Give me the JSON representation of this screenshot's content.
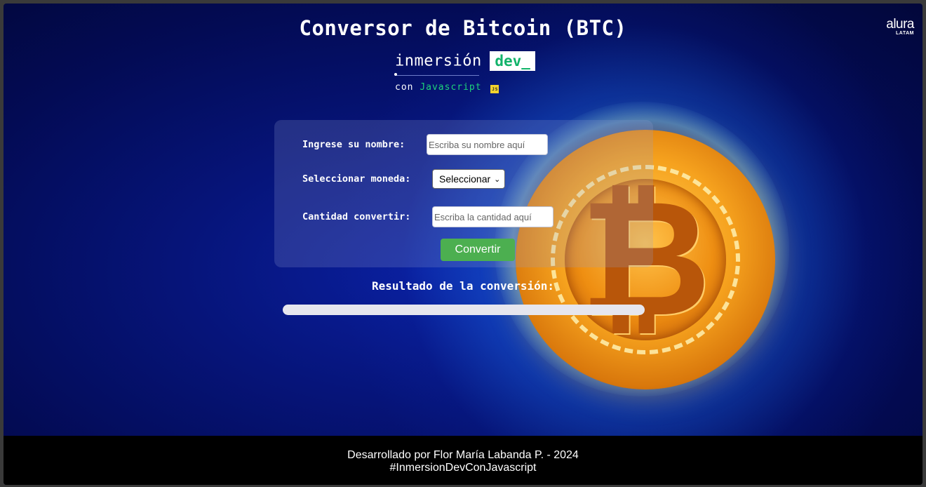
{
  "header": {
    "title": "Conversor de Bitcoin (BTC)",
    "brand_main": "alura",
    "brand_sub": "LATAM"
  },
  "logo": {
    "word": "inmersión",
    "dev": "dev_",
    "con": "con",
    "lang": "Javascript",
    "badge": "JS"
  },
  "form": {
    "name_label": "Ingrese su nombre:",
    "name_placeholder": "Escriba su nombre aquí",
    "currency_label": "Seleccionar moneda:",
    "currency_selected": "Seleccionar",
    "amount_label": "Cantidad convertir:",
    "amount_placeholder": "Escriba la cantidad aquí",
    "convert_button": "Convertir"
  },
  "result": {
    "title": "Resultado de la conversión:"
  },
  "footer": {
    "line1": "Desarrollado por Flor María Labanda P. - 2024",
    "line2": "#InmersionDevConJavascript"
  },
  "colors": {
    "button": "#4caf50",
    "accent_green": "#1fd27a",
    "background": "#061479"
  }
}
